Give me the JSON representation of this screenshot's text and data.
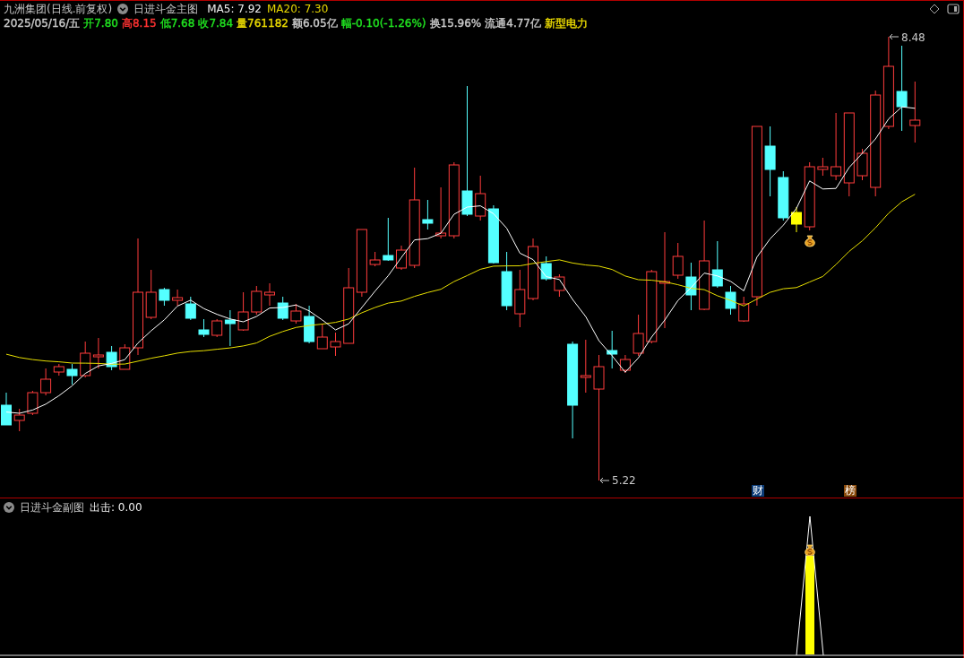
{
  "header": {
    "title": "九洲集团(日线.前复权)",
    "indicator": "日进斗金主图",
    "ma5": "MA5: 7.92",
    "ma20": "MA20: 7.30"
  },
  "quote": [
    {
      "text": "2025/05/16/五",
      "color": "#c8c8c8"
    },
    {
      "text": "开7.80",
      "color": "#20e020"
    },
    {
      "text": "高8.15",
      "color": "#ff3232"
    },
    {
      "text": "低7.68",
      "color": "#20e020"
    },
    {
      "text": "收7.84",
      "color": "#20e020"
    },
    {
      "text": "量761182",
      "color": "#e8d800"
    },
    {
      "text": "额6.05亿",
      "color": "#c8c8c8"
    },
    {
      "text": "幅-0.10(-1.26%)",
      "color": "#20e020"
    },
    {
      "text": "换15.96%",
      "color": "#c8c8c8"
    },
    {
      "text": "流通4.77亿",
      "color": "#c8c8c8"
    },
    {
      "text": "新型电力",
      "color": "#e8d800"
    }
  ],
  "chart": {
    "high_label": "8.48",
    "low_label": "5.22"
  },
  "events": [
    {
      "text": "财",
      "color": "#0c3c78"
    },
    {
      "text": "榜",
      "color": "#8a4a0a"
    }
  ],
  "sub_panel": {
    "title": "日进斗金副图",
    "reading": "出击: 0.00"
  }
}
